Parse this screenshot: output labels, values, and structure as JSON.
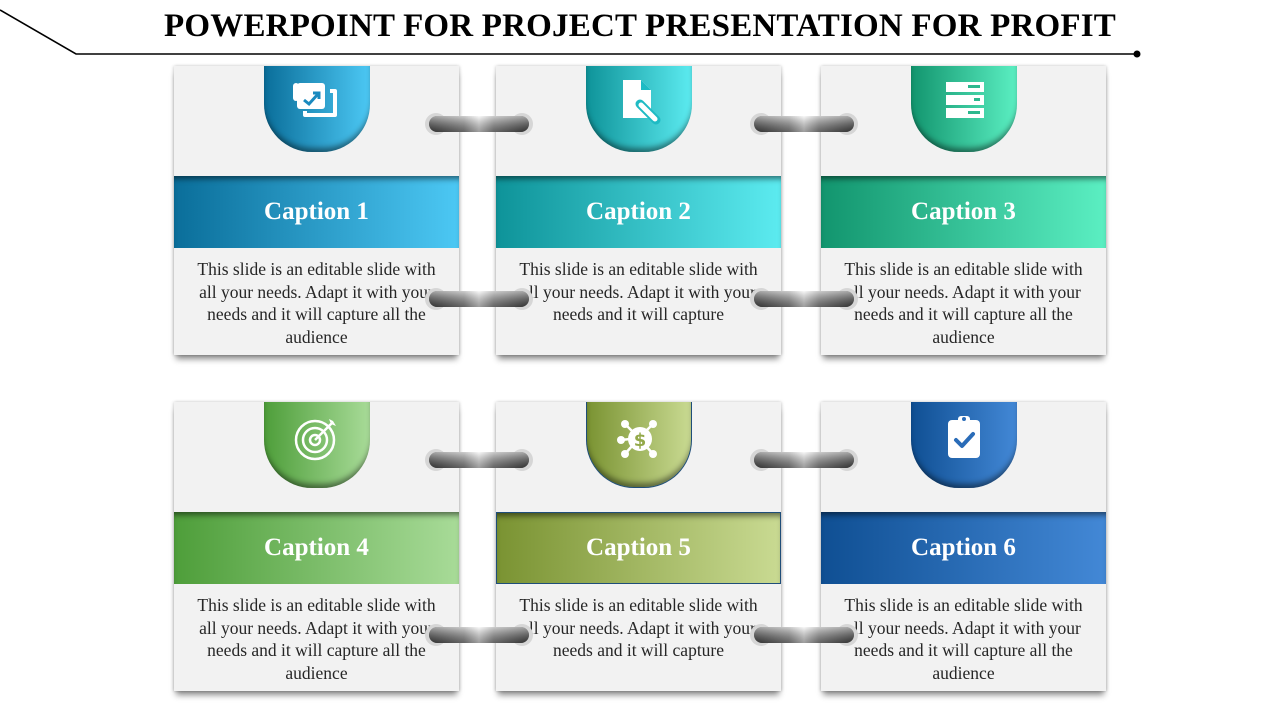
{
  "slide": {
    "title": "POWERPOINT FOR PROJECT PRESENTATION FOR PROFIT"
  },
  "cards": [
    {
      "caption": "Caption 1",
      "description": "This slide is an editable slide with all your needs. Adapt it with your needs and it will capture all the audience",
      "icon": "presentation-chart-icon",
      "color_start": "#0A6E9A",
      "color_end": "#4CC8F4"
    },
    {
      "caption": "Caption 2",
      "description": "This slide is an editable slide with all your needs. Adapt it with your needs and it will capture",
      "icon": "document-edit-icon",
      "color_start": "#0E9399",
      "color_end": "#5CEBF0"
    },
    {
      "caption": "Caption 3",
      "description": "This slide is an editable slide with all your needs. Adapt it with your needs and it will capture all the audience",
      "icon": "server-stack-icon",
      "color_start": "#12956E",
      "color_end": "#5BEFC2"
    },
    {
      "caption": "Caption 4",
      "description": "This slide is an editable slide with all your needs. Adapt it with your needs and it will capture all the audience",
      "icon": "target-icon",
      "color_start": "#4E9E3A",
      "color_end": "#A8DB98"
    },
    {
      "caption": "Caption 5",
      "description": "This slide is an editable slide with all your needs. Adapt it with your needs and it will capture",
      "icon": "money-network-icon",
      "color_start": "#7A9332",
      "color_end": "#C9DA92"
    },
    {
      "caption": "Caption 6",
      "description": "This slide is an editable slide with all your needs. Adapt it with your needs and it will capture all the audience",
      "icon": "clipboard-check-icon",
      "color_start": "#0F4F93",
      "color_end": "#4388D6"
    }
  ]
}
